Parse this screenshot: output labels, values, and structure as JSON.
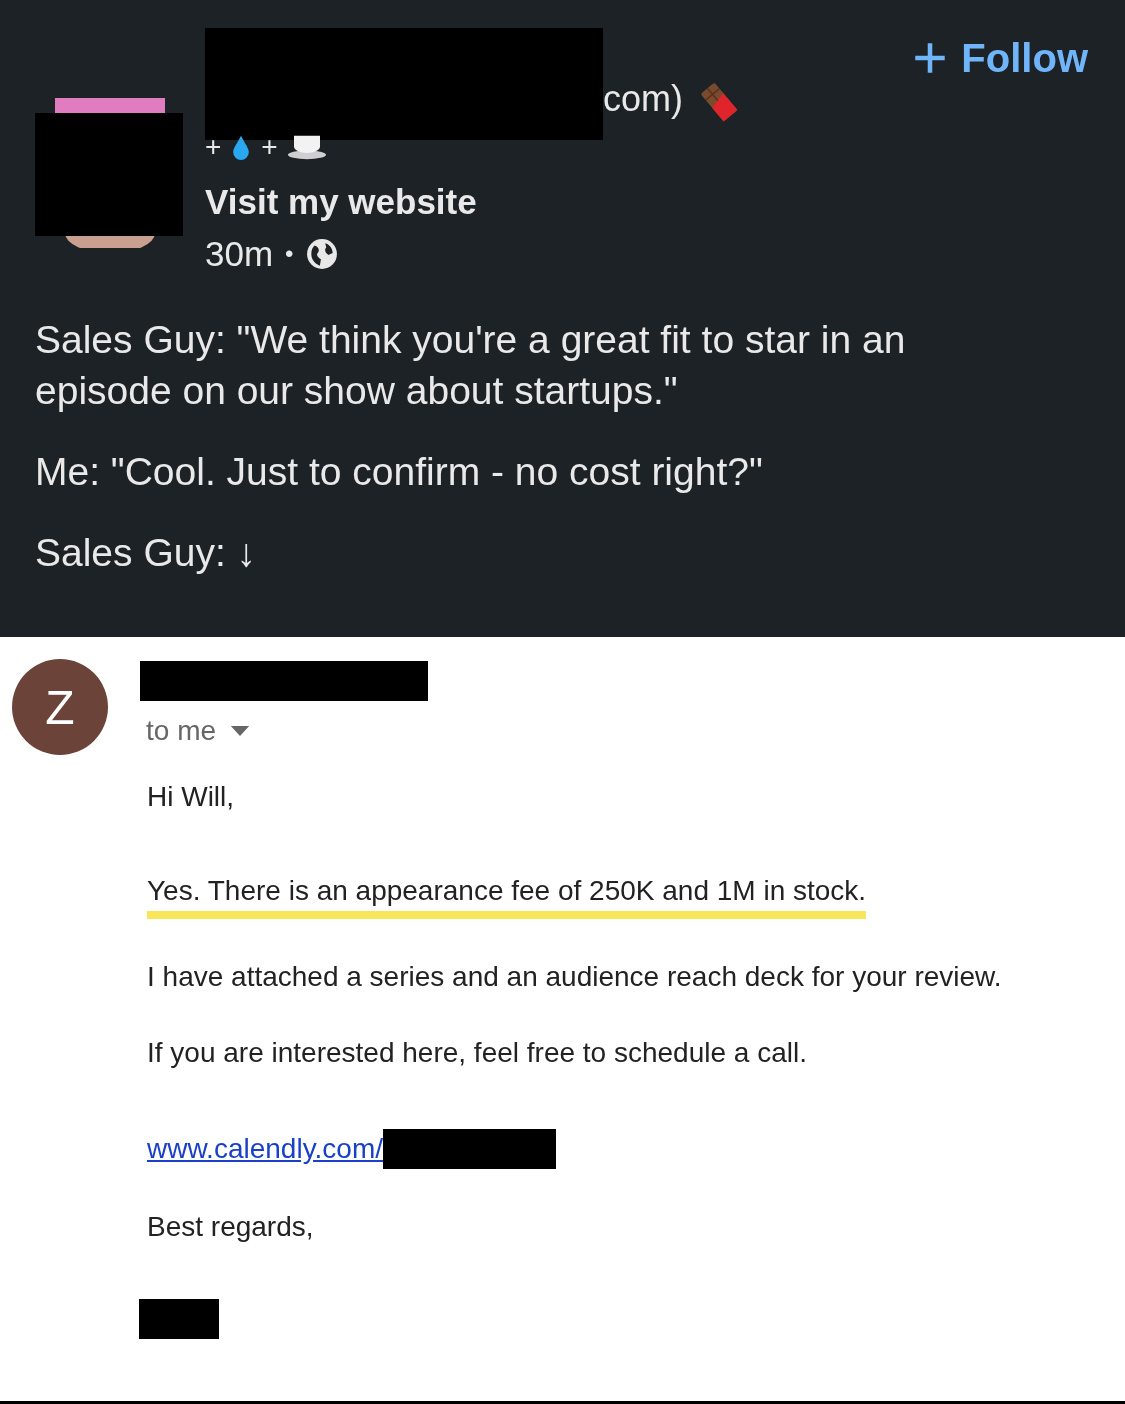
{
  "post": {
    "follow_label": "Follow",
    "headline_fragment": "com)",
    "tagline_marks": [
      "+",
      "+"
    ],
    "website_link": "Visit my website",
    "time": "30m",
    "separator": "•",
    "paragraphs": [
      "Sales Guy: \"We think you're a great fit to star in an episode on our show about startups.\"",
      "Me: \"Cool. Just to confirm - no cost right?\"",
      "Sales Guy: ↓"
    ]
  },
  "email": {
    "avatar_letter": "Z",
    "recipient": "to me",
    "greeting": "Hi Will,",
    "paragraphs": [
      {
        "text": "Yes. There is an appearance fee of 250K and 1M in stock.",
        "highlighted": true
      },
      {
        "text": "I have attached a series and an audience reach deck for your review.",
        "highlighted": false
      },
      {
        "text": "If you are interested here, feel free to schedule a call.",
        "highlighted": false
      }
    ],
    "link": "www.calendly.com/",
    "signoff": "Best regards,"
  }
}
